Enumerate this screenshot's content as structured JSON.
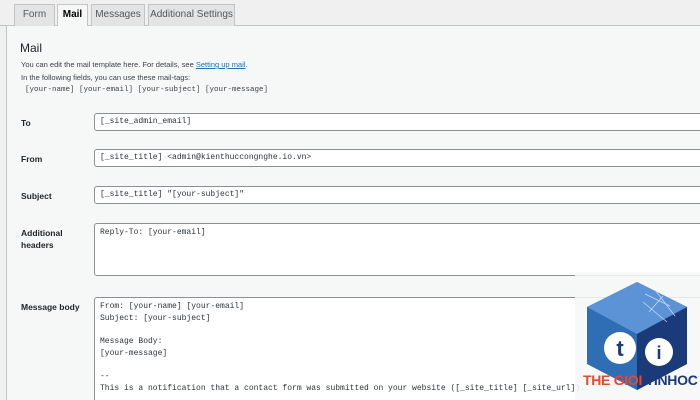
{
  "tabs": [
    {
      "label": "Form",
      "active": false
    },
    {
      "label": "Mail",
      "active": true
    },
    {
      "label": "Messages",
      "active": false
    },
    {
      "label": "Additional Settings",
      "active": false
    }
  ],
  "mail": {
    "title": "Mail",
    "desc1_prefix": "You can edit the mail template here. For details, see ",
    "desc1_link": "Setting up mail",
    "desc1_suffix": ".",
    "desc2": "In the following fields, you can use these mail-tags:",
    "tags": "[your-name] [your-email] [your-subject] [your-message]"
  },
  "fields": {
    "to": {
      "label": "To",
      "value": "[_site_admin_email]"
    },
    "from": {
      "label": "From",
      "value": "[_site_title] <admin@kienthuccongnghe.io.vn>"
    },
    "subject": {
      "label": "Subject",
      "value": "[_site_title] \"[your-subject]\""
    },
    "additional_headers": {
      "label": "Additional headers",
      "label_line1": "Additional",
      "label_line2": "headers",
      "value": "Reply-To: [your-email]"
    },
    "message_body": {
      "label": "Message body",
      "lines": [
        "From: [your-name] [your-email]",
        "Subject: [your-subject]",
        "",
        "Message Body:",
        "[your-message]",
        "",
        "--",
        "This is a notification that a contact form was submitted on your website ([_site_title] [_site_url])."
      ]
    }
  },
  "watermark": {
    "text_part1": "THE GIOI",
    "text_part2": "TINHOC",
    "logo_letters": "ti",
    "colors": {
      "red": "#e24a2c",
      "blue": "#1b3a7a",
      "mid": "#2f6db5"
    }
  }
}
